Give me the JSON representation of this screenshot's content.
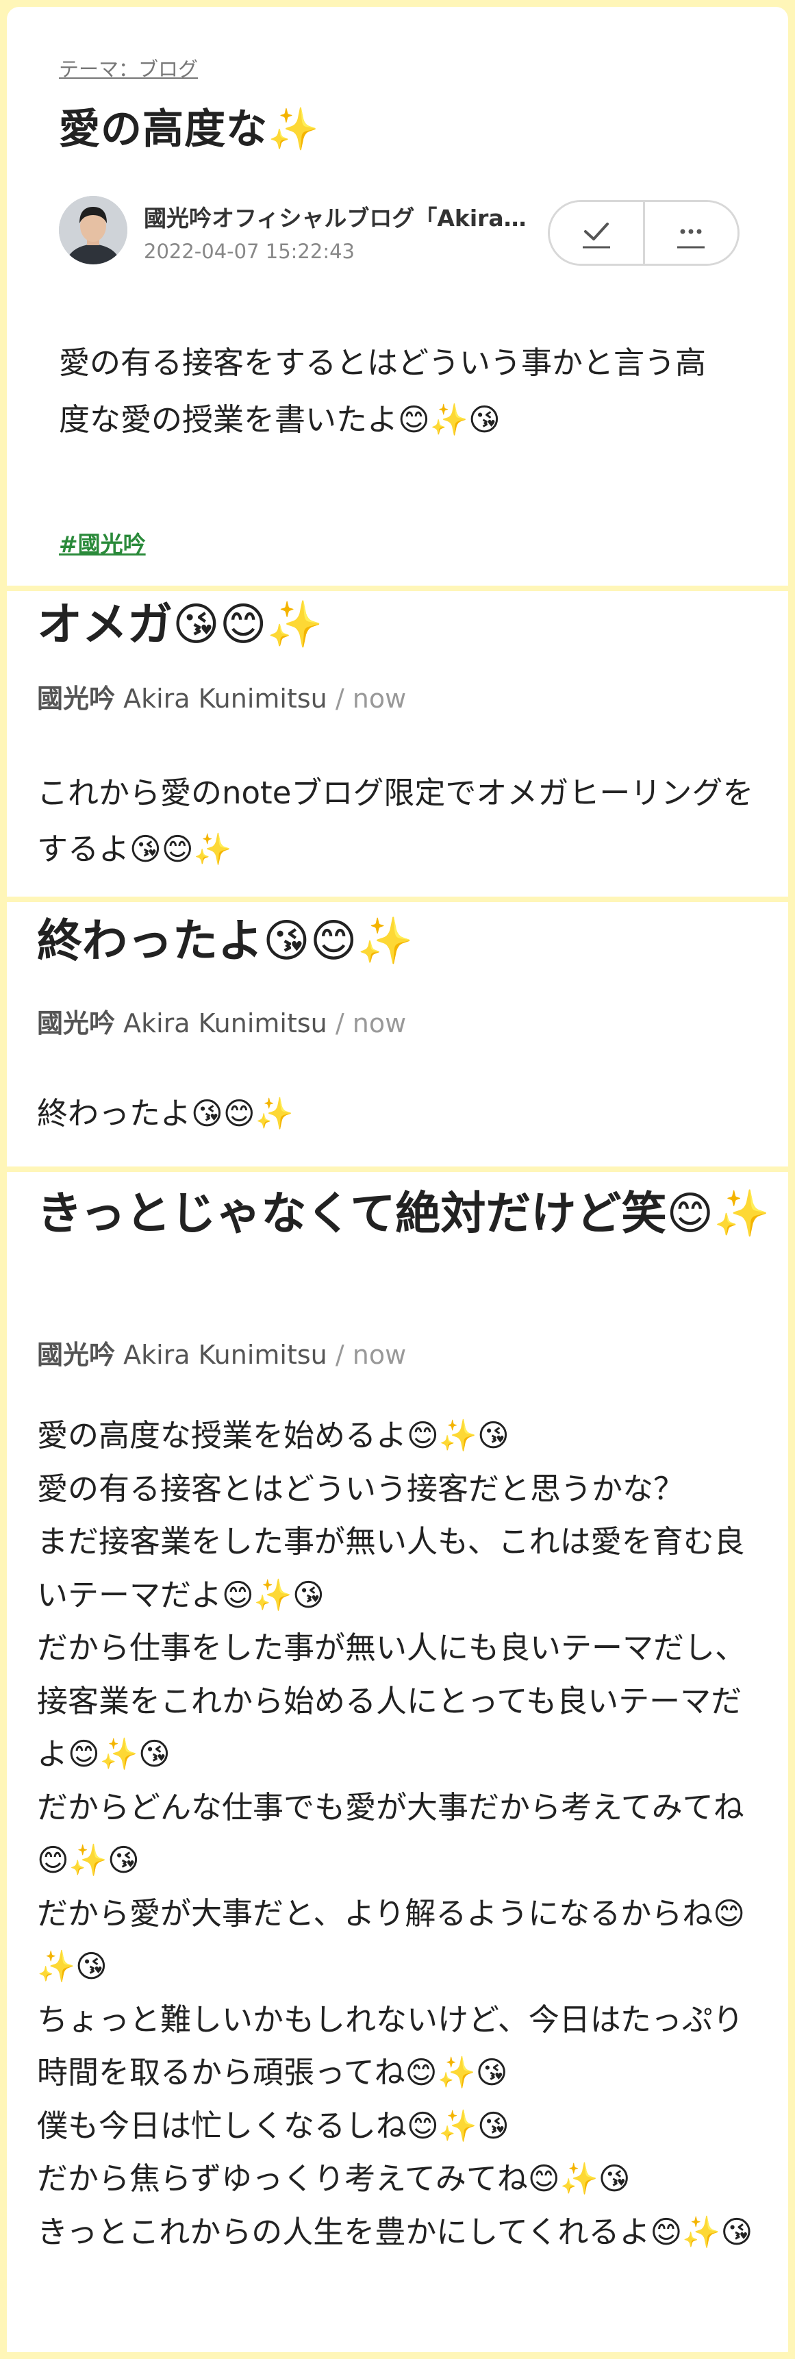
{
  "blog_post": {
    "theme_link": "テーマ：ブログ",
    "title": "愛の高度な✨",
    "author": "國光吟オフィシャルブログ「Akira…",
    "date": "2022-04-07 15:22:43",
    "body": "愛の有る接客をするとはどういう事かと言う高度な愛の授業を書いたよ😊✨😘",
    "hashtag": "#國光吟",
    "icons": {
      "check": "check-icon",
      "more": "more-icon"
    }
  },
  "note_posts": [
    {
      "title": "オメガ😘😊✨",
      "author_ja": "國光吟",
      "author_en": "Akira Kunimitsu",
      "time": "/ now",
      "body": "これから愛のnoteブログ限定でオメガヒーリングをするよ😘😊✨"
    },
    {
      "title": "終わったよ😘😊✨",
      "author_ja": "國光吟",
      "author_en": "Akira Kunimitsu",
      "time": "/ now",
      "body": "終わったよ😘😊✨"
    },
    {
      "title": "きっとじゃなくて絶対だけど笑😊✨",
      "author_ja": "國光吟",
      "author_en": "Akira Kunimitsu",
      "time": "/ now",
      "body": "愛の高度な授業を始めるよ😊✨😘\n愛の有る接客とはどういう接客だと思うかな？\nまだ接客業をした事が無い人も、これは愛を育む良いテーマだよ😊✨😘\nだから仕事をした事が無い人にも良いテーマだし、接客業をこれから始める人にとっても良いテーマだよ😊✨😘\nだからどんな仕事でも愛が大事だから考えてみてね😊✨😘\nだから愛が大事だと、より解るようになるからね😊✨😘\nちょっと難しいかもしれないけど、今日はたっぷり時間を取るから頑張ってね😊✨😘\n僕も今日は忙しくなるしね😊✨😘\nだから焦らずゆっくり考えてみてね😊✨😘\nきっとこれからの人生を豊かにしてくれるよ😊✨😘"
    }
  ]
}
